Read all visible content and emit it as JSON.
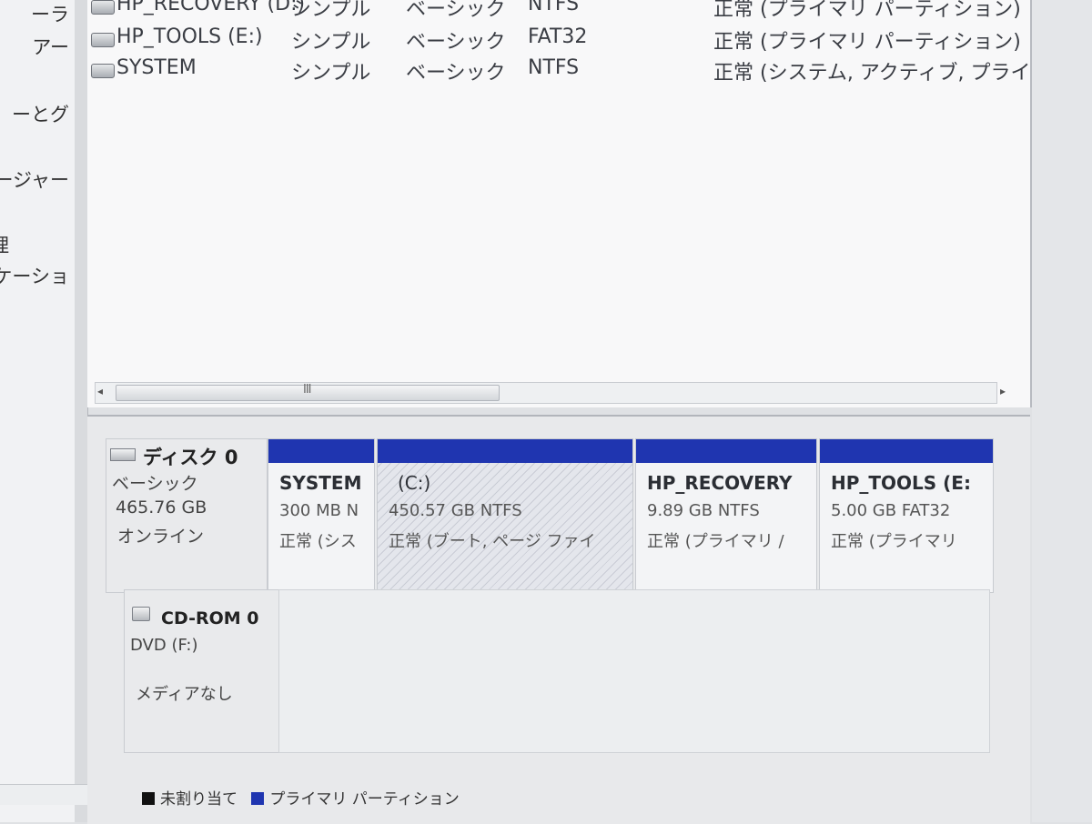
{
  "nav": {
    "items": [
      "ーラ",
      "アー",
      "ーとグ",
      "ージャー",
      "理",
      "ケーショ"
    ]
  },
  "volumes": [
    {
      "name": "HP_RECOVERY (D:)",
      "layout": "シンプル",
      "type": "ベーシック",
      "fs": "NTFS",
      "status": "正常 (プライマリ パーティション)"
    },
    {
      "name": "HP_TOOLS (E:)",
      "layout": "シンプル",
      "type": "ベーシック",
      "fs": "FAT32",
      "status": "正常 (プライマリ パーティション)"
    },
    {
      "name": "SYSTEM",
      "layout": "シンプル",
      "type": "ベーシック",
      "fs": "NTFS",
      "status": "正常 (システム, アクティブ, プライ"
    }
  ],
  "scrollbar": {
    "grip": "III",
    "left_arrow": "◂",
    "right_arrow": "▸"
  },
  "disk0": {
    "name": "ディスク 0",
    "type": "ベーシック",
    "size": "465.76 GB",
    "state": "オンライン",
    "partitions": [
      {
        "title": "SYSTEM",
        "size": "300 MB N",
        "status": "正常 (シス"
      },
      {
        "title": "(C:)",
        "size": "450.57 GB NTFS",
        "status": "正常 (ブート, ページ ファイ"
      },
      {
        "title": "HP_RECOVERY",
        "size": "9.89 GB NTFS",
        "status": "正常 (プライマリ /"
      },
      {
        "title": "HP_TOOLS (E:",
        "size": "5.00 GB FAT32",
        "status": "正常 (プライマリ"
      }
    ]
  },
  "cdrom0": {
    "name": "CD-ROM 0",
    "drive": "DVD (F:)",
    "media": "メディアなし"
  },
  "legend": {
    "unallocated": "未割り当て",
    "primary": "プライマリ パーティション",
    "unallocated_color": "#111111",
    "primary_color": "#1f35b0"
  },
  "left_scroll_arrow": "▸"
}
